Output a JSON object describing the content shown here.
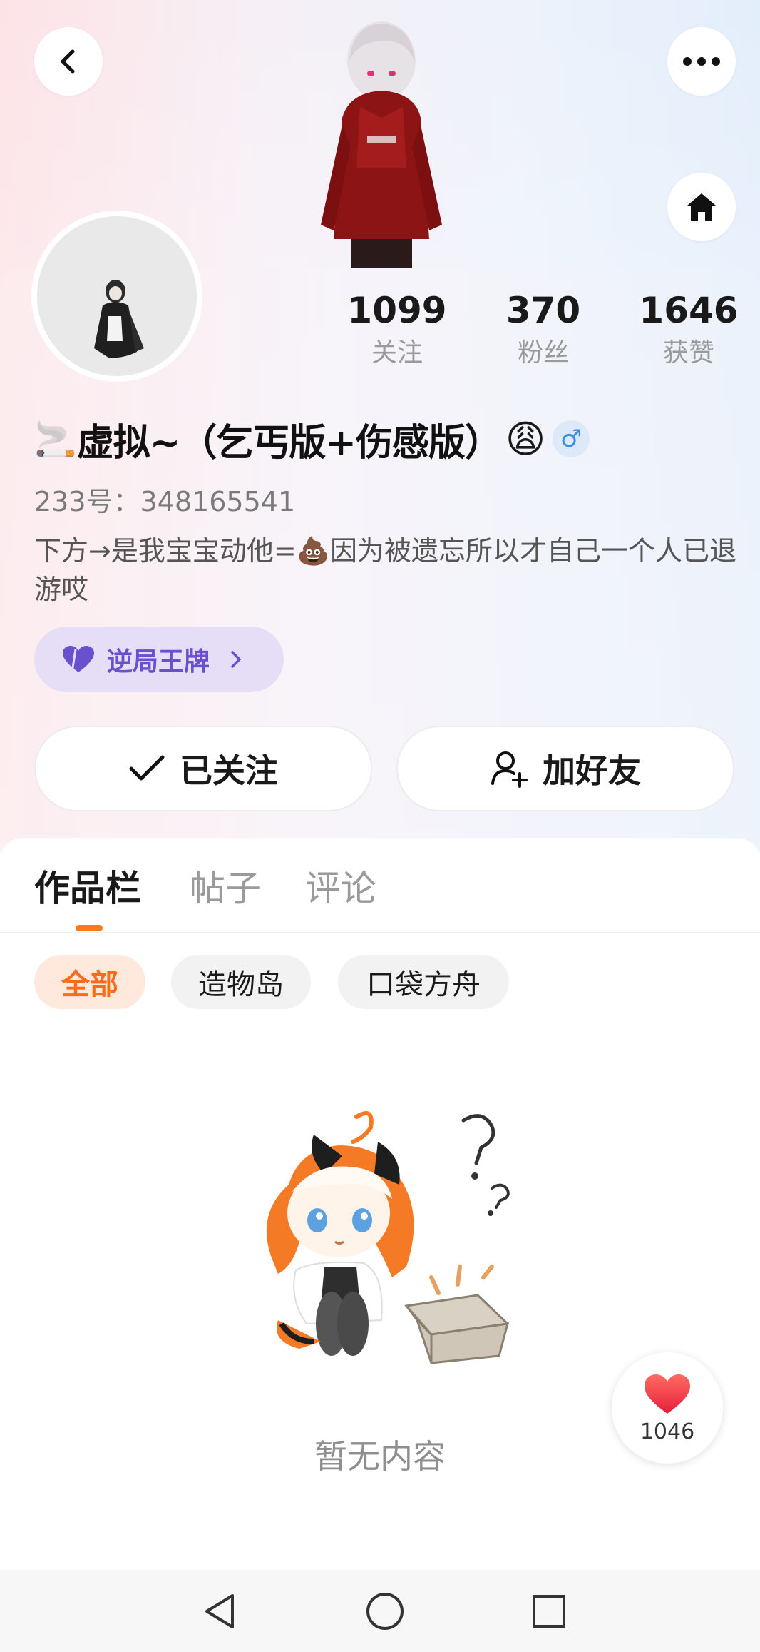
{
  "header": {
    "back_icon": "chevron-left-icon",
    "more_icon": "more-horizontal-icon",
    "home_icon": "home-icon"
  },
  "stats": [
    {
      "value": "1099",
      "label": "关注"
    },
    {
      "value": "370",
      "label": "粉丝"
    },
    {
      "value": "1646",
      "label": "获赞"
    }
  ],
  "profile": {
    "username_prefix_emoji": "🚬",
    "username": "虚拟~（乞丐版+伤感版）",
    "username_suffix_emoji": "😩",
    "gender_symbol": "♂",
    "uid": "233号：348165541",
    "bio": "下方→是我宝宝动他=💩因为被遗忘所以才自己一个人已退游哎",
    "badge_label": "逆局王牌"
  },
  "actions": {
    "follow_label": "已关注",
    "add_friend_label": "加好友"
  },
  "tabs": [
    {
      "label": "作品栏",
      "active": true
    },
    {
      "label": "帖子",
      "active": false
    },
    {
      "label": "评论",
      "active": false
    }
  ],
  "filters": [
    {
      "label": "全部",
      "active": true
    },
    {
      "label": "造物岛",
      "active": false
    },
    {
      "label": "口袋方舟",
      "active": false
    }
  ],
  "empty_state": {
    "text": "暂无内容"
  },
  "like_fab": {
    "count": "1046"
  },
  "colors": {
    "accent_orange": "#ff7a1a",
    "badge_purple": "#6a4fcf",
    "like_red": "#f0343f"
  }
}
